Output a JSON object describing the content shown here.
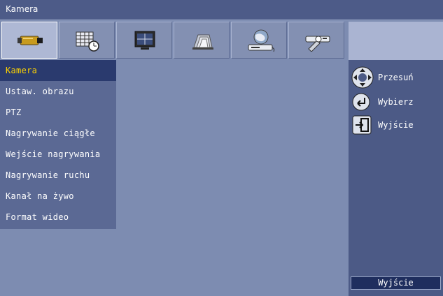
{
  "window": {
    "title": "Kamera"
  },
  "tabs": [
    {
      "icon": "camera-icon",
      "active": true
    },
    {
      "icon": "schedule-icon",
      "active": false
    },
    {
      "icon": "monitor-icon",
      "active": false
    },
    {
      "icon": "archive-icon",
      "active": false
    },
    {
      "icon": "network-icon",
      "active": false
    },
    {
      "icon": "tools-icon",
      "active": false
    }
  ],
  "menu": {
    "items": [
      {
        "label": "Kamera",
        "active": true
      },
      {
        "label": "Ustaw. obrazu"
      },
      {
        "label": "PTZ"
      },
      {
        "label": "Nagrywanie ciągłe"
      },
      {
        "label": "Wejście nagrywania"
      },
      {
        "label": "Nagrywanie ruchu"
      },
      {
        "label": "Kanał na żywo"
      },
      {
        "label": "Format wideo"
      }
    ]
  },
  "hints": {
    "move": "Przesuń",
    "select": "Wybierz",
    "exit": "Wyjście"
  },
  "exit_button": {
    "label": "Wyjście"
  },
  "colors": {
    "background": "#7d8cb1",
    "panel": "#4c5a86",
    "menu_selected": "#2a3a6e",
    "selected_text": "#ffd400"
  }
}
